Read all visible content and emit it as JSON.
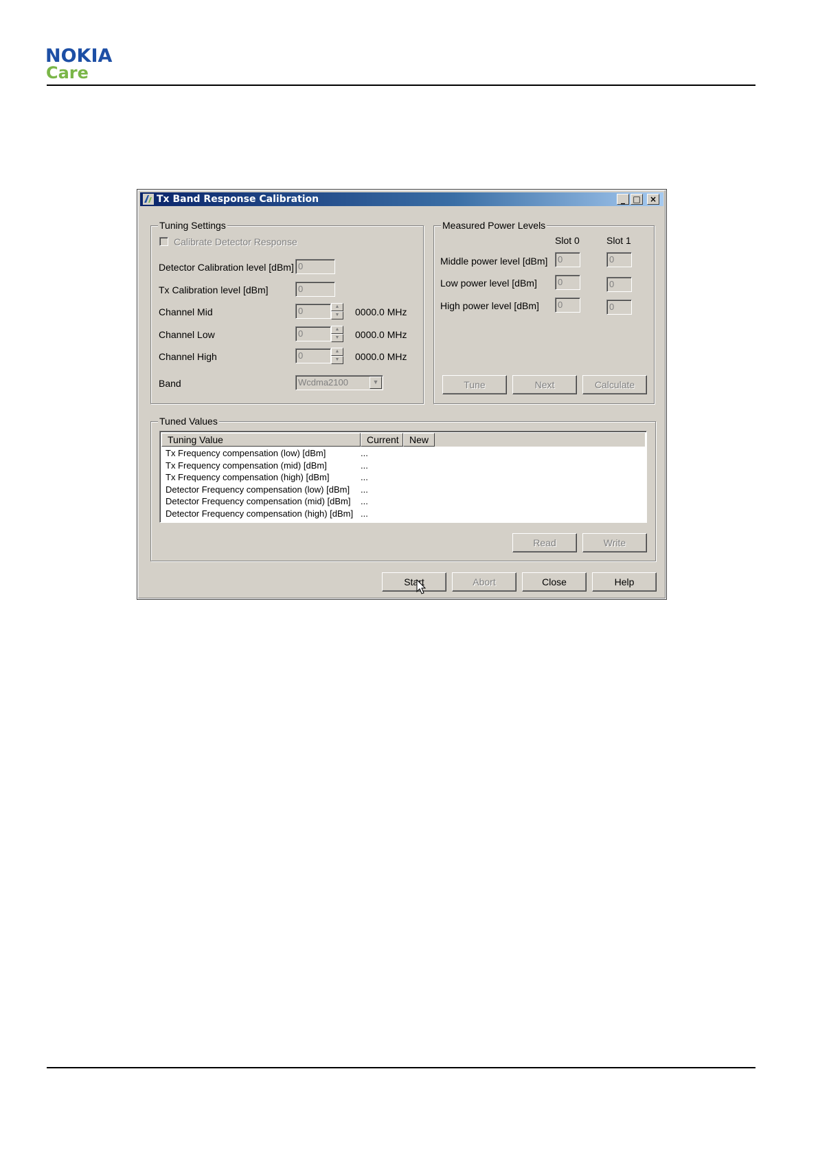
{
  "header": {
    "brand": "NOKIA",
    "sub_brand": "Care"
  },
  "window": {
    "title": "Tx Band Response Calibration",
    "controls": {
      "minimize": "_",
      "maximize": "□",
      "close": "×"
    },
    "icon": "app-icon"
  },
  "tuning_settings": {
    "label": "Tuning Settings",
    "calibrate_detector_response": "Calibrate Detector Response",
    "detector_calibration_level": {
      "label": "Detector Calibration level [dBm]",
      "value": "0"
    },
    "tx_calibration_level": {
      "label": "Tx Calibration level [dBm]",
      "value": "0"
    },
    "channel_mid": {
      "label": "Channel Mid",
      "value": "0",
      "freq": "0000.0 MHz"
    },
    "channel_low": {
      "label": "Channel Low",
      "value": "0",
      "freq": "0000.0 MHz"
    },
    "channel_high": {
      "label": "Channel High",
      "value": "0",
      "freq": "0000.0 MHz"
    },
    "band": {
      "label": "Band",
      "value": "Wcdma2100"
    }
  },
  "measured_power": {
    "label": "Measured Power Levels",
    "slot0": "Slot 0",
    "slot1": "Slot 1",
    "middle": {
      "label": "Middle power level [dBm]",
      "slot0": "0",
      "slot1": "0"
    },
    "low": {
      "label": "Low power level [dBm]",
      "slot0": "0",
      "slot1": "0"
    },
    "high": {
      "label": "High power level [dBm]",
      "slot0": "0",
      "slot1": "0"
    },
    "buttons": {
      "tune": "Tune",
      "next": "Next",
      "calculate": "Calculate"
    }
  },
  "tuned_values": {
    "label": "Tuned Values",
    "columns": {
      "tuning_value": "Tuning Value",
      "current": "Current",
      "new": "New"
    },
    "rows": [
      {
        "name": "Tx Frequency compensation (low) [dBm]",
        "current": "..."
      },
      {
        "name": "Tx Frequency compensation (mid) [dBm]",
        "current": "..."
      },
      {
        "name": "Tx Frequency compensation (high) [dBm]",
        "current": "..."
      },
      {
        "name": "Detector Frequency compensation (low) [dBm]",
        "current": "..."
      },
      {
        "name": "Detector Frequency compensation (mid) [dBm]",
        "current": "..."
      },
      {
        "name": "Detector Frequency compensation (high) [dBm]",
        "current": "..."
      }
    ],
    "buttons": {
      "read": "Read",
      "write": "Write"
    }
  },
  "footer_buttons": {
    "start": "Start",
    "abort": "Abort",
    "close": "Close",
    "help": "Help"
  }
}
